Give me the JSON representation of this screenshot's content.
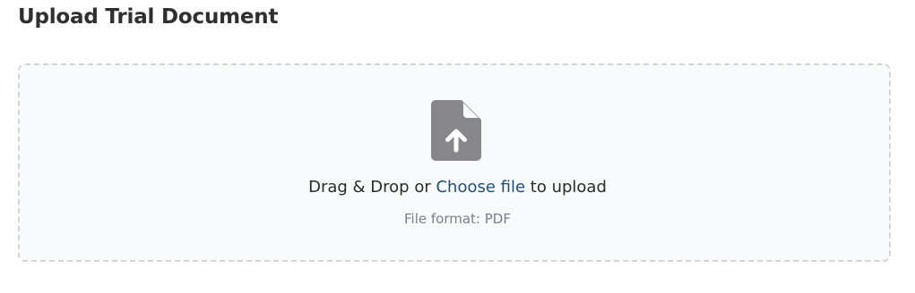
{
  "page": {
    "title": "Upload Trial Document"
  },
  "dropzone": {
    "icon": "file-upload-icon",
    "icon_color": "#87878b",
    "prompt_prefix": "Drag & Drop or ",
    "choose_link": "Choose file",
    "prompt_suffix": " to upload",
    "link_color": "#1e4e79",
    "format_hint": "File format: PDF"
  }
}
